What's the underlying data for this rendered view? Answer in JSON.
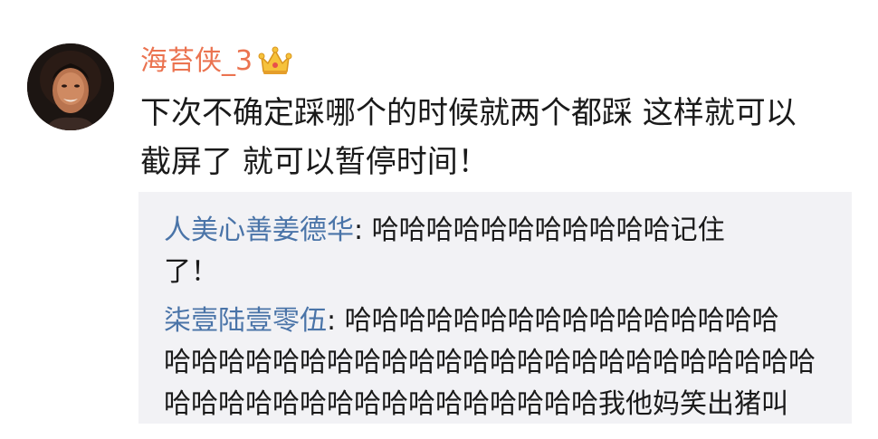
{
  "comment": {
    "username": "海苔侠_3",
    "badge_icon": "crown-icon",
    "text_lines": [
      "下次不确定踩哪个的时候就两个都踩 这样就可以",
      "截屏了 就可以暂停时间！"
    ]
  },
  "replies": [
    {
      "author": "人美心善姜德华",
      "separator": ": ",
      "first_line": "哈哈哈哈哈哈哈哈哈哈哈记住",
      "more_lines": [
        "了！"
      ]
    },
    {
      "author": "柒壹陆壹零伍",
      "separator": ": ",
      "first_line": "哈哈哈哈哈哈哈哈哈哈哈哈哈哈哈哈",
      "more_lines": [
        "哈哈哈哈哈哈哈哈哈哈哈哈哈哈哈哈哈哈哈哈哈哈哈哈",
        "哈哈哈哈哈哈哈哈哈哈哈哈哈哈哈哈我他妈笑出猪叫"
      ]
    }
  ],
  "colors": {
    "username": "#eb7350",
    "reply_author": "#4a74a8",
    "replies_background": "#f2f2f5",
    "text": "#1a1a1a"
  }
}
